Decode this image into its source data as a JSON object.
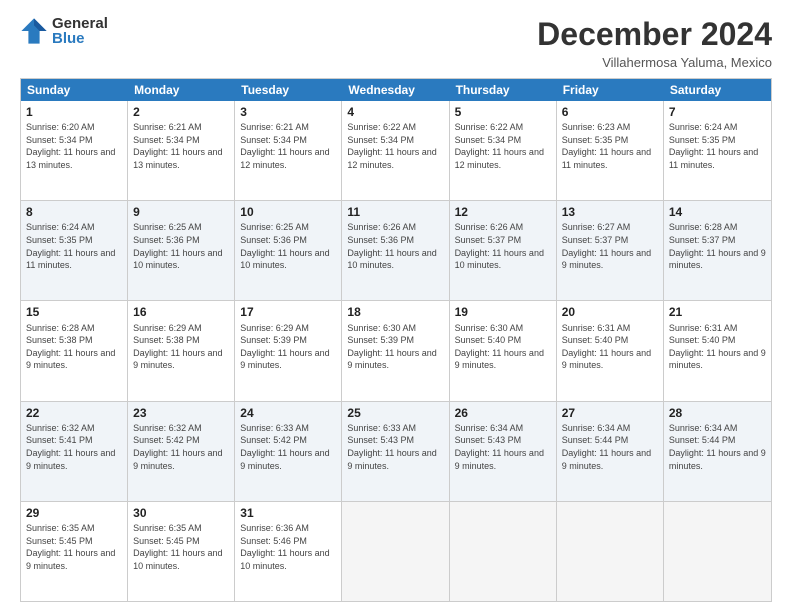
{
  "logo": {
    "general": "General",
    "blue": "Blue"
  },
  "title": "December 2024",
  "location": "Villahermosa Yaluma, Mexico",
  "days_of_week": [
    "Sunday",
    "Monday",
    "Tuesday",
    "Wednesday",
    "Thursday",
    "Friday",
    "Saturday"
  ],
  "weeks": [
    [
      {
        "day": "1",
        "sunrise": "6:20 AM",
        "sunset": "5:34 PM",
        "daylight": "11 hours and 13 minutes."
      },
      {
        "day": "2",
        "sunrise": "6:21 AM",
        "sunset": "5:34 PM",
        "daylight": "11 hours and 13 minutes."
      },
      {
        "day": "3",
        "sunrise": "6:21 AM",
        "sunset": "5:34 PM",
        "daylight": "11 hours and 12 minutes."
      },
      {
        "day": "4",
        "sunrise": "6:22 AM",
        "sunset": "5:34 PM",
        "daylight": "11 hours and 12 minutes."
      },
      {
        "day": "5",
        "sunrise": "6:22 AM",
        "sunset": "5:34 PM",
        "daylight": "11 hours and 12 minutes."
      },
      {
        "day": "6",
        "sunrise": "6:23 AM",
        "sunset": "5:35 PM",
        "daylight": "11 hours and 11 minutes."
      },
      {
        "day": "7",
        "sunrise": "6:24 AM",
        "sunset": "5:35 PM",
        "daylight": "11 hours and 11 minutes."
      }
    ],
    [
      {
        "day": "8",
        "sunrise": "6:24 AM",
        "sunset": "5:35 PM",
        "daylight": "11 hours and 11 minutes."
      },
      {
        "day": "9",
        "sunrise": "6:25 AM",
        "sunset": "5:36 PM",
        "daylight": "11 hours and 10 minutes."
      },
      {
        "day": "10",
        "sunrise": "6:25 AM",
        "sunset": "5:36 PM",
        "daylight": "11 hours and 10 minutes."
      },
      {
        "day": "11",
        "sunrise": "6:26 AM",
        "sunset": "5:36 PM",
        "daylight": "11 hours and 10 minutes."
      },
      {
        "day": "12",
        "sunrise": "6:26 AM",
        "sunset": "5:37 PM",
        "daylight": "11 hours and 10 minutes."
      },
      {
        "day": "13",
        "sunrise": "6:27 AM",
        "sunset": "5:37 PM",
        "daylight": "11 hours and 9 minutes."
      },
      {
        "day": "14",
        "sunrise": "6:28 AM",
        "sunset": "5:37 PM",
        "daylight": "11 hours and 9 minutes."
      }
    ],
    [
      {
        "day": "15",
        "sunrise": "6:28 AM",
        "sunset": "5:38 PM",
        "daylight": "11 hours and 9 minutes."
      },
      {
        "day": "16",
        "sunrise": "6:29 AM",
        "sunset": "5:38 PM",
        "daylight": "11 hours and 9 minutes."
      },
      {
        "day": "17",
        "sunrise": "6:29 AM",
        "sunset": "5:39 PM",
        "daylight": "11 hours and 9 minutes."
      },
      {
        "day": "18",
        "sunrise": "6:30 AM",
        "sunset": "5:39 PM",
        "daylight": "11 hours and 9 minutes."
      },
      {
        "day": "19",
        "sunrise": "6:30 AM",
        "sunset": "5:40 PM",
        "daylight": "11 hours and 9 minutes."
      },
      {
        "day": "20",
        "sunrise": "6:31 AM",
        "sunset": "5:40 PM",
        "daylight": "11 hours and 9 minutes."
      },
      {
        "day": "21",
        "sunrise": "6:31 AM",
        "sunset": "5:40 PM",
        "daylight": "11 hours and 9 minutes."
      }
    ],
    [
      {
        "day": "22",
        "sunrise": "6:32 AM",
        "sunset": "5:41 PM",
        "daylight": "11 hours and 9 minutes."
      },
      {
        "day": "23",
        "sunrise": "6:32 AM",
        "sunset": "5:42 PM",
        "daylight": "11 hours and 9 minutes."
      },
      {
        "day": "24",
        "sunrise": "6:33 AM",
        "sunset": "5:42 PM",
        "daylight": "11 hours and 9 minutes."
      },
      {
        "day": "25",
        "sunrise": "6:33 AM",
        "sunset": "5:43 PM",
        "daylight": "11 hours and 9 minutes."
      },
      {
        "day": "26",
        "sunrise": "6:34 AM",
        "sunset": "5:43 PM",
        "daylight": "11 hours and 9 minutes."
      },
      {
        "day": "27",
        "sunrise": "6:34 AM",
        "sunset": "5:44 PM",
        "daylight": "11 hours and 9 minutes."
      },
      {
        "day": "28",
        "sunrise": "6:34 AM",
        "sunset": "5:44 PM",
        "daylight": "11 hours and 9 minutes."
      }
    ],
    [
      {
        "day": "29",
        "sunrise": "6:35 AM",
        "sunset": "5:45 PM",
        "daylight": "11 hours and 9 minutes."
      },
      {
        "day": "30",
        "sunrise": "6:35 AM",
        "sunset": "5:45 PM",
        "daylight": "11 hours and 10 minutes."
      },
      {
        "day": "31",
        "sunrise": "6:36 AM",
        "sunset": "5:46 PM",
        "daylight": "11 hours and 10 minutes."
      },
      null,
      null,
      null,
      null
    ]
  ]
}
